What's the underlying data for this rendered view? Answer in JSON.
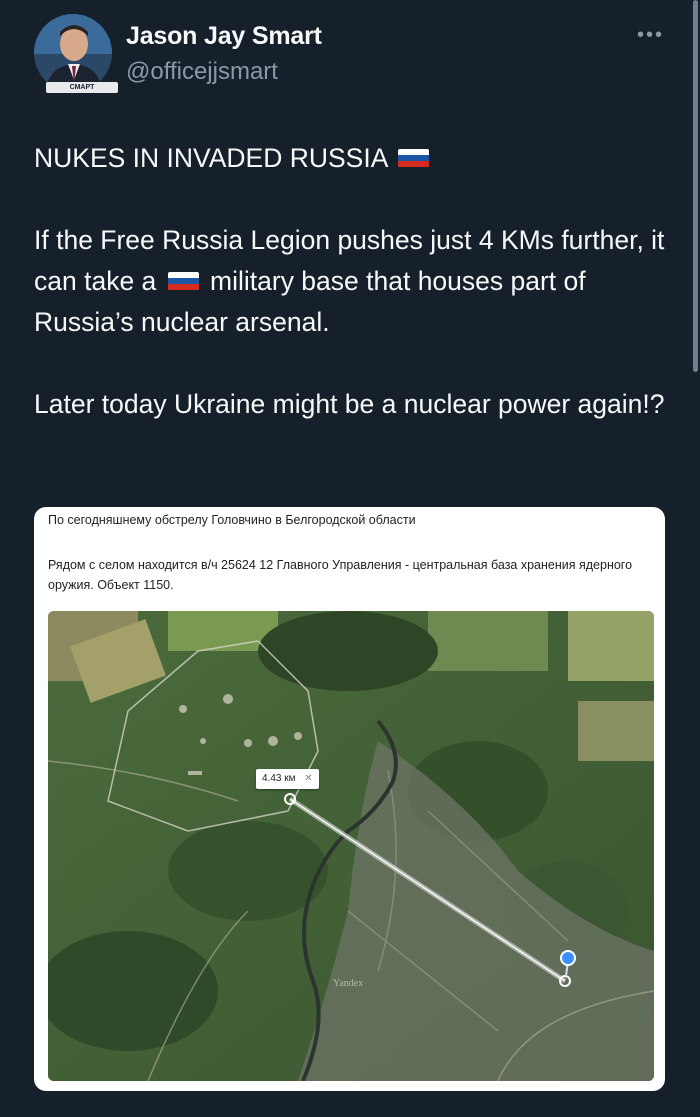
{
  "author": {
    "name": "Jason Jay Smart",
    "handle": "@officejjsmart",
    "avatar_label": "СМАРТ"
  },
  "more_label": "•••",
  "tweet": {
    "line1": "NUKES IN INVADED RUSSIA",
    "p2_a": "If the Free Russia Legion pushes just 4 KMs further, it can take a",
    "p2_b": "military base that houses part of Russia’s nuclear arsenal.",
    "p3": "Later today Ukraine might be a nuclear power again!?"
  },
  "embed": {
    "title": "По сегодняшнему обстрелу Головчино в Белгородской области",
    "description": "Рядом с селом находится в/ч 25624 12 Главного Управления - центральная база хранения ядерного оружия. Объект 1150.",
    "map": {
      "distance_label": "4.43 км",
      "distance_close": "✕",
      "watermark": "Yandex"
    }
  },
  "colors": {
    "background": "#15202b",
    "text": "#f7f9f9",
    "secondary": "#8b98a5",
    "flag": [
      "#ffffff",
      "#1c57a5",
      "#d52b1e"
    ]
  }
}
